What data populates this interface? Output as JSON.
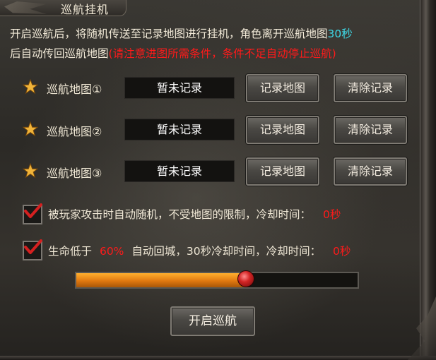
{
  "window": {
    "title": "巡航挂机"
  },
  "description": {
    "line1_prefix": "开启巡航后，将随机传送至记录地图进行挂机，角色离开巡航地图",
    "line1_seconds": "30秒",
    "line2_prefix": "后自动传回巡航地图",
    "line2_warning": "(请注意进图所需条件，条件不足自动停止巡航)"
  },
  "maps": [
    {
      "label": "巡航地图①",
      "value": "暂未记录",
      "record_label": "记录地图",
      "clear_label": "清除记录"
    },
    {
      "label": "巡航地图②",
      "value": "暂未记录",
      "record_label": "记录地图",
      "clear_label": "清除记录"
    },
    {
      "label": "巡航地图③",
      "value": "暂未记录",
      "record_label": "记录地图",
      "clear_label": "清除记录"
    }
  ],
  "options": {
    "attack_random": {
      "checked": true,
      "text": "被玩家攻击时自动随机，不受地图的限制，冷却时间：",
      "cooldown": "0秒"
    },
    "low_hp": {
      "checked": true,
      "prefix": "生命低于",
      "percent": "60%",
      "text": "自动回城，30秒冷却时间，冷却时间：",
      "cooldown": "0秒"
    }
  },
  "hp_slider": {
    "value": 0.6
  },
  "start_button": {
    "label": "开启巡航"
  },
  "colors": {
    "accent_cyan": "#3fd8e6",
    "warning_red": "#ff1a1a",
    "slider_orange": "#e07810"
  }
}
